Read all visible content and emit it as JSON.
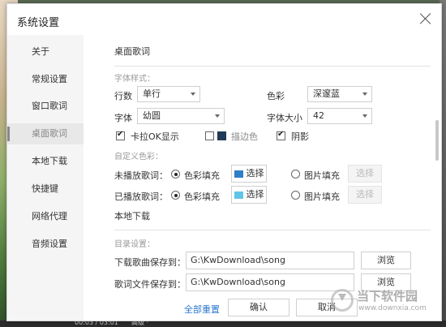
{
  "background": {
    "status_time": "00:03 / 03:01",
    "status_extra": "高级 ·"
  },
  "window": {
    "title": "系统设置"
  },
  "sidebar": {
    "items": [
      {
        "label": "关于"
      },
      {
        "label": "常规设置"
      },
      {
        "label": "窗口歌词"
      },
      {
        "label": "桌面歌词"
      },
      {
        "label": "本地下载"
      },
      {
        "label": "快捷键"
      },
      {
        "label": "网络代理"
      },
      {
        "label": "音频设置"
      }
    ],
    "active_index": 3
  },
  "desktop_lyrics": {
    "section_title": "桌面歌词",
    "font_style_title": "字体样式：",
    "rows_label": "行数",
    "rows_value": "单行",
    "color_label": "色彩",
    "color_value": "深邃蓝",
    "font_label": "字体",
    "font_value": "幼圆",
    "size_label": "字体大小",
    "size_value": "42",
    "karaoke_label": "卡拉OK显示",
    "karaoke_checked": true,
    "stroke_label": "描边色",
    "stroke_checked": false,
    "stroke_color": "#1f3b57",
    "shadow_label": "阴影",
    "shadow_checked": true,
    "custom_color_title": "自定义色彩：",
    "unplayed_label": "未播放歌词：",
    "played_label": "已播放歌词：",
    "color_fill_label": "色彩填充",
    "select_button": "选择",
    "image_fill_label": "图片填充",
    "select_button_disabled": "选择",
    "unplayed_swatch": "#2f7fc8",
    "played_swatch": "#5fc4e8"
  },
  "local_download": {
    "section_title": "本地下载",
    "dir_title": "目录设置：",
    "song_dir_label": "下载歌曲保存到：",
    "song_dir_value": "G:\\KwDownload\\song",
    "lyric_dir_label": "歌词文件保存到：",
    "lyric_dir_value": "G:\\KwDownload\\song",
    "browse_button": "浏览"
  },
  "footer": {
    "reset_all": "全部重置",
    "confirm": "确认",
    "cancel": "取消"
  },
  "watermark": {
    "text": "当下软件园",
    "url": "www.downxia.com"
  }
}
